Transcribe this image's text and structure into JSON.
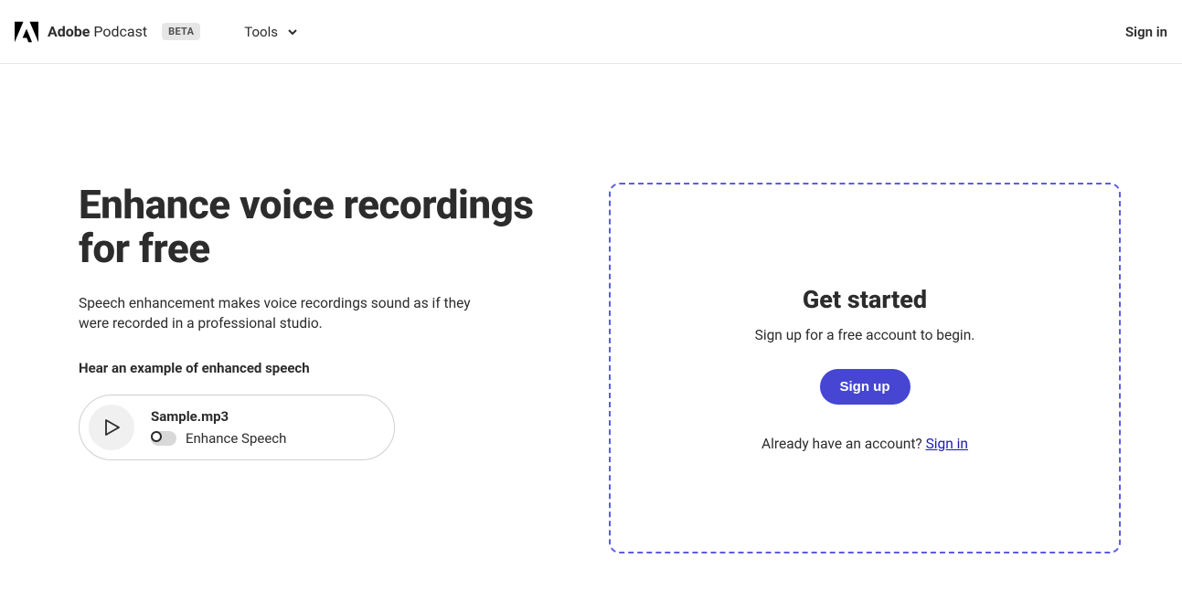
{
  "header": {
    "brand_bold": "Adobe",
    "brand_light": " Podcast",
    "beta": "BETA",
    "tools": "Tools",
    "signin": "Sign in"
  },
  "hero": {
    "heading": "Enhance voice recordings for free",
    "subtext": "Speech enhancement makes voice recordings sound as if they were recorded in a professional studio.",
    "example_label": "Hear an example of enhanced speech",
    "filename": "Sample.mp3",
    "toggle_label": "Enhance Speech"
  },
  "dropzone": {
    "title": "Get started",
    "subtitle": "Sign up for a free account to begin.",
    "signup": "Sign up",
    "already_prefix": "Already have an account? ",
    "already_link": "Sign in"
  },
  "colors": {
    "accent": "#5c5ce0",
    "button": "#4646d3"
  }
}
